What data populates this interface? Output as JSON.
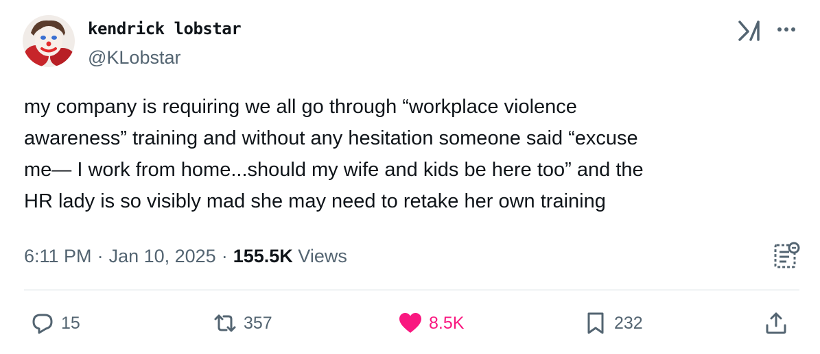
{
  "author": {
    "display_name": "kendrick lobstar",
    "handle": "@KLobstar",
    "avatar_icon": "clown-avatar"
  },
  "tweet": {
    "text": "my company is requiring we all go through “workplace violence\nawareness” training and without any hesitation someone said “excuse\nme— I work from home...should my wife and kids be here too” and the\nHR lady is so visibly mad she may need to retake her own training"
  },
  "meta": {
    "time": "6:11 PM",
    "date": "Jan 10, 2025",
    "separator": "·",
    "views_count": "155.5K",
    "views_label": "Views"
  },
  "actions": {
    "replies": "15",
    "reposts": "357",
    "likes": "8.5K",
    "bookmarks": "232"
  },
  "colors": {
    "text": "#0f1419",
    "secondary": "#536471",
    "like": "#f91880",
    "divider": "#cfd9de"
  }
}
